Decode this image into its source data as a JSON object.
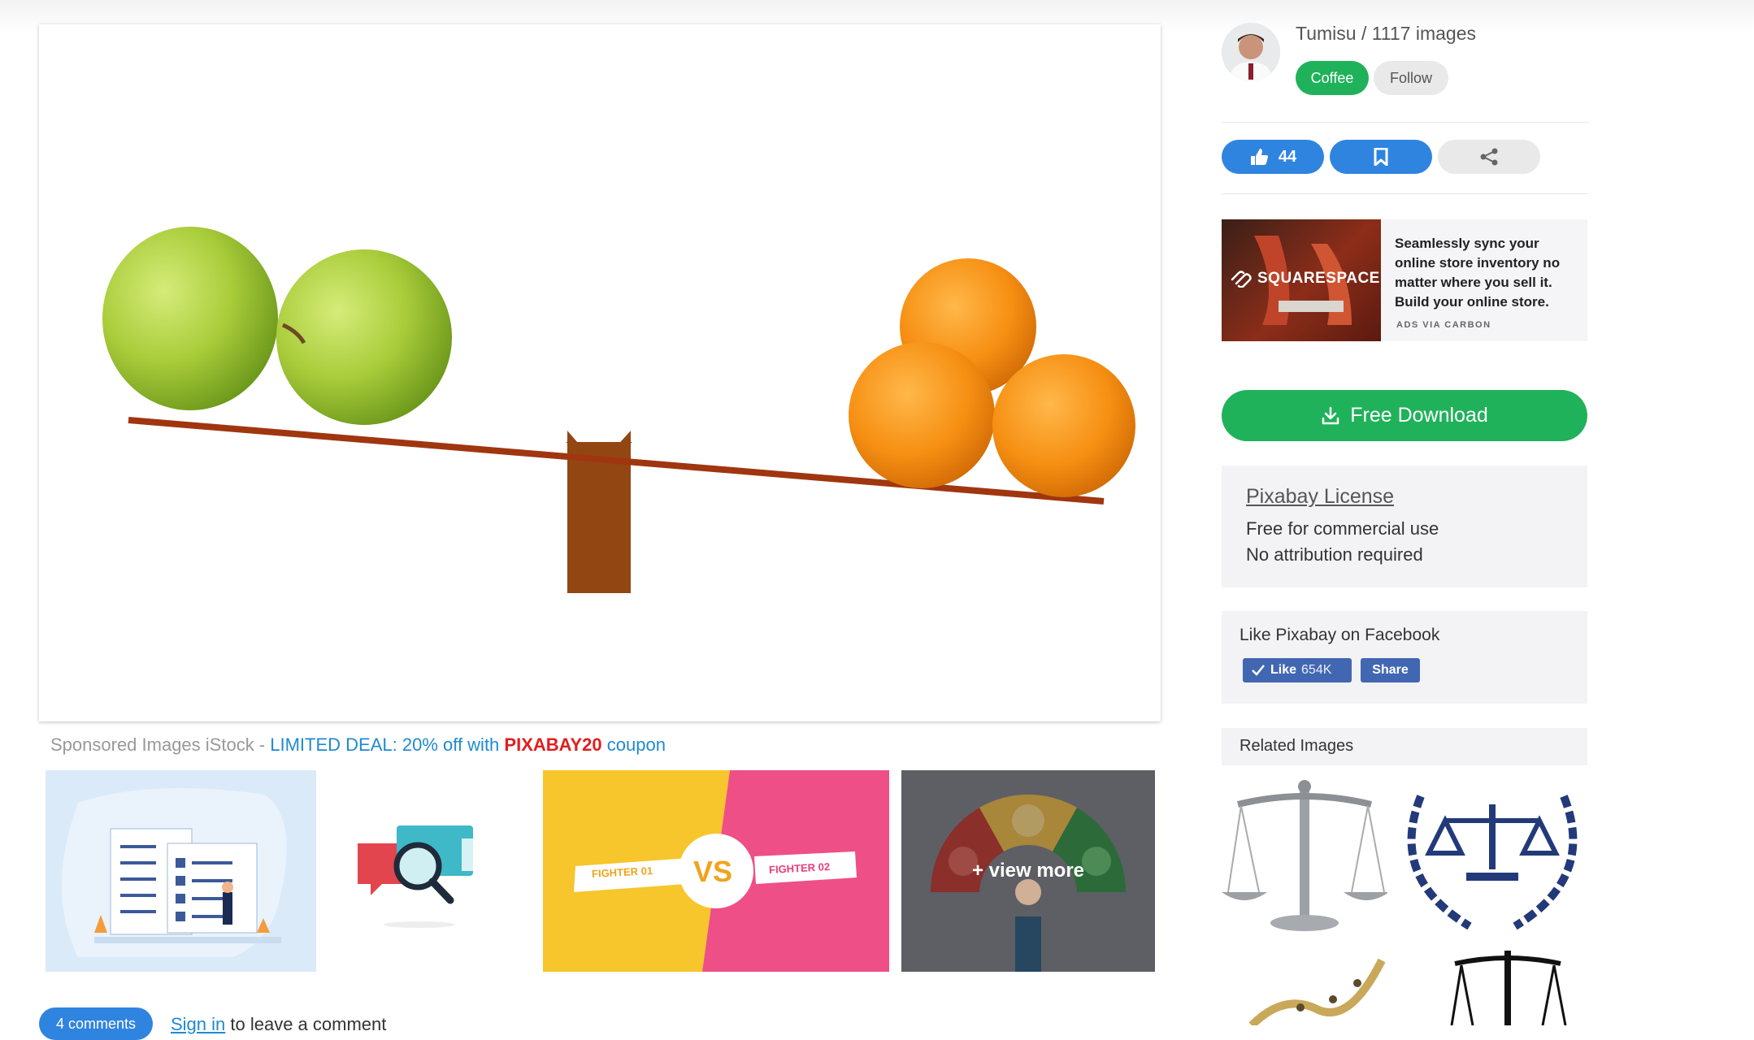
{
  "author": {
    "name_line": "Tumisu / 1117 images",
    "coffee_label": "Coffee",
    "follow_label": "Follow"
  },
  "actions": {
    "like_count": "44"
  },
  "ad": {
    "brand": "SQUARESPACE",
    "text": "Seamlessly sync your online store inventory no matter where you sell it. Build your online store.",
    "via": "ADS VIA CARBON"
  },
  "download": {
    "label": "Free Download"
  },
  "license": {
    "title": "Pixabay License",
    "line1": "Free for commercial use",
    "line2": "No attribution required"
  },
  "facebook": {
    "title": "Like Pixabay on Facebook",
    "like_label": "Like",
    "like_count": "654K",
    "share_label": "Share"
  },
  "related": {
    "title": "Related Images"
  },
  "sponsored": {
    "prefix": "Sponsored Images iStock - ",
    "deal": "LIMITED DEAL: 20% off with ",
    "code": "PIXABAY20",
    "suffix": " coupon"
  },
  "thumbs": {
    "fighter1": "FIGHTER 01",
    "fighter2": "FIGHTER 02",
    "vs": "VS",
    "view_more": "+ view more"
  },
  "comments": {
    "button": "4 comments",
    "signin": "Sign in",
    "rest": " to leave a comment"
  },
  "colors": {
    "accent_blue": "#2f84e0",
    "green": "#20b25a",
    "beam": "#a0360f",
    "fulcrum": "#924713"
  }
}
